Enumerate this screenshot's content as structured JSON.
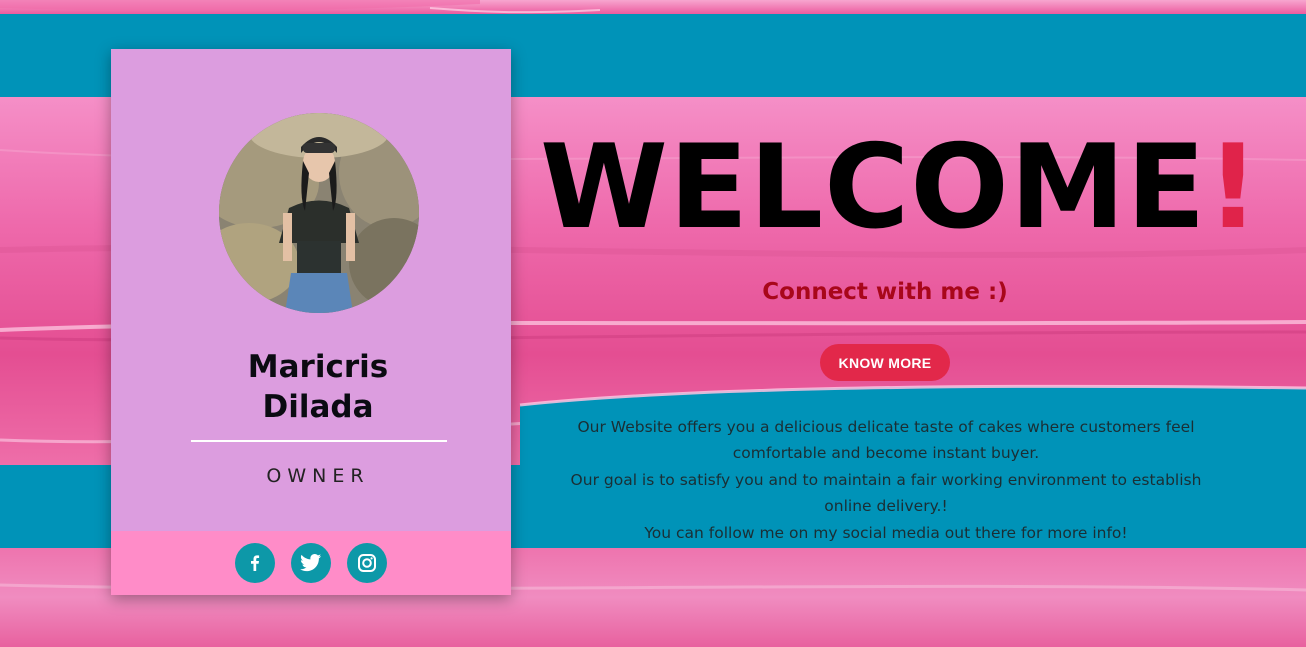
{
  "profile": {
    "name_line1": "Maricris",
    "name_line2": "Dilada",
    "role": "OWNER",
    "avatar_alt": "profile photo"
  },
  "social": [
    {
      "name": "facebook",
      "icon": "facebook-icon"
    },
    {
      "name": "twitter",
      "icon": "twitter-icon"
    },
    {
      "name": "instagram",
      "icon": "instagram-icon"
    }
  ],
  "hero": {
    "welcome_text": "WELCOME",
    "welcome_excl": "!",
    "connect_text": "Connect with me :)",
    "button_label": "KNOW MORE"
  },
  "about": {
    "line1": "Our Website offers you a delicious delicate taste of cakes where customers feel comfortable and become instant buyer.",
    "line2": "Our goal is to satisfy you and to maintain a fair working environment to establish online delivery.!",
    "line3": "You can follow me on my social media out there for more info!"
  },
  "colors": {
    "teal_bg": "#0093b8",
    "pink_band": "#ee69ab",
    "card_bg": "#dc9ddf",
    "social_bar": "#ff8cc8",
    "social_btn": "#0d98a8",
    "accent_red": "#e2284a",
    "connect_text": "#a8071a"
  }
}
